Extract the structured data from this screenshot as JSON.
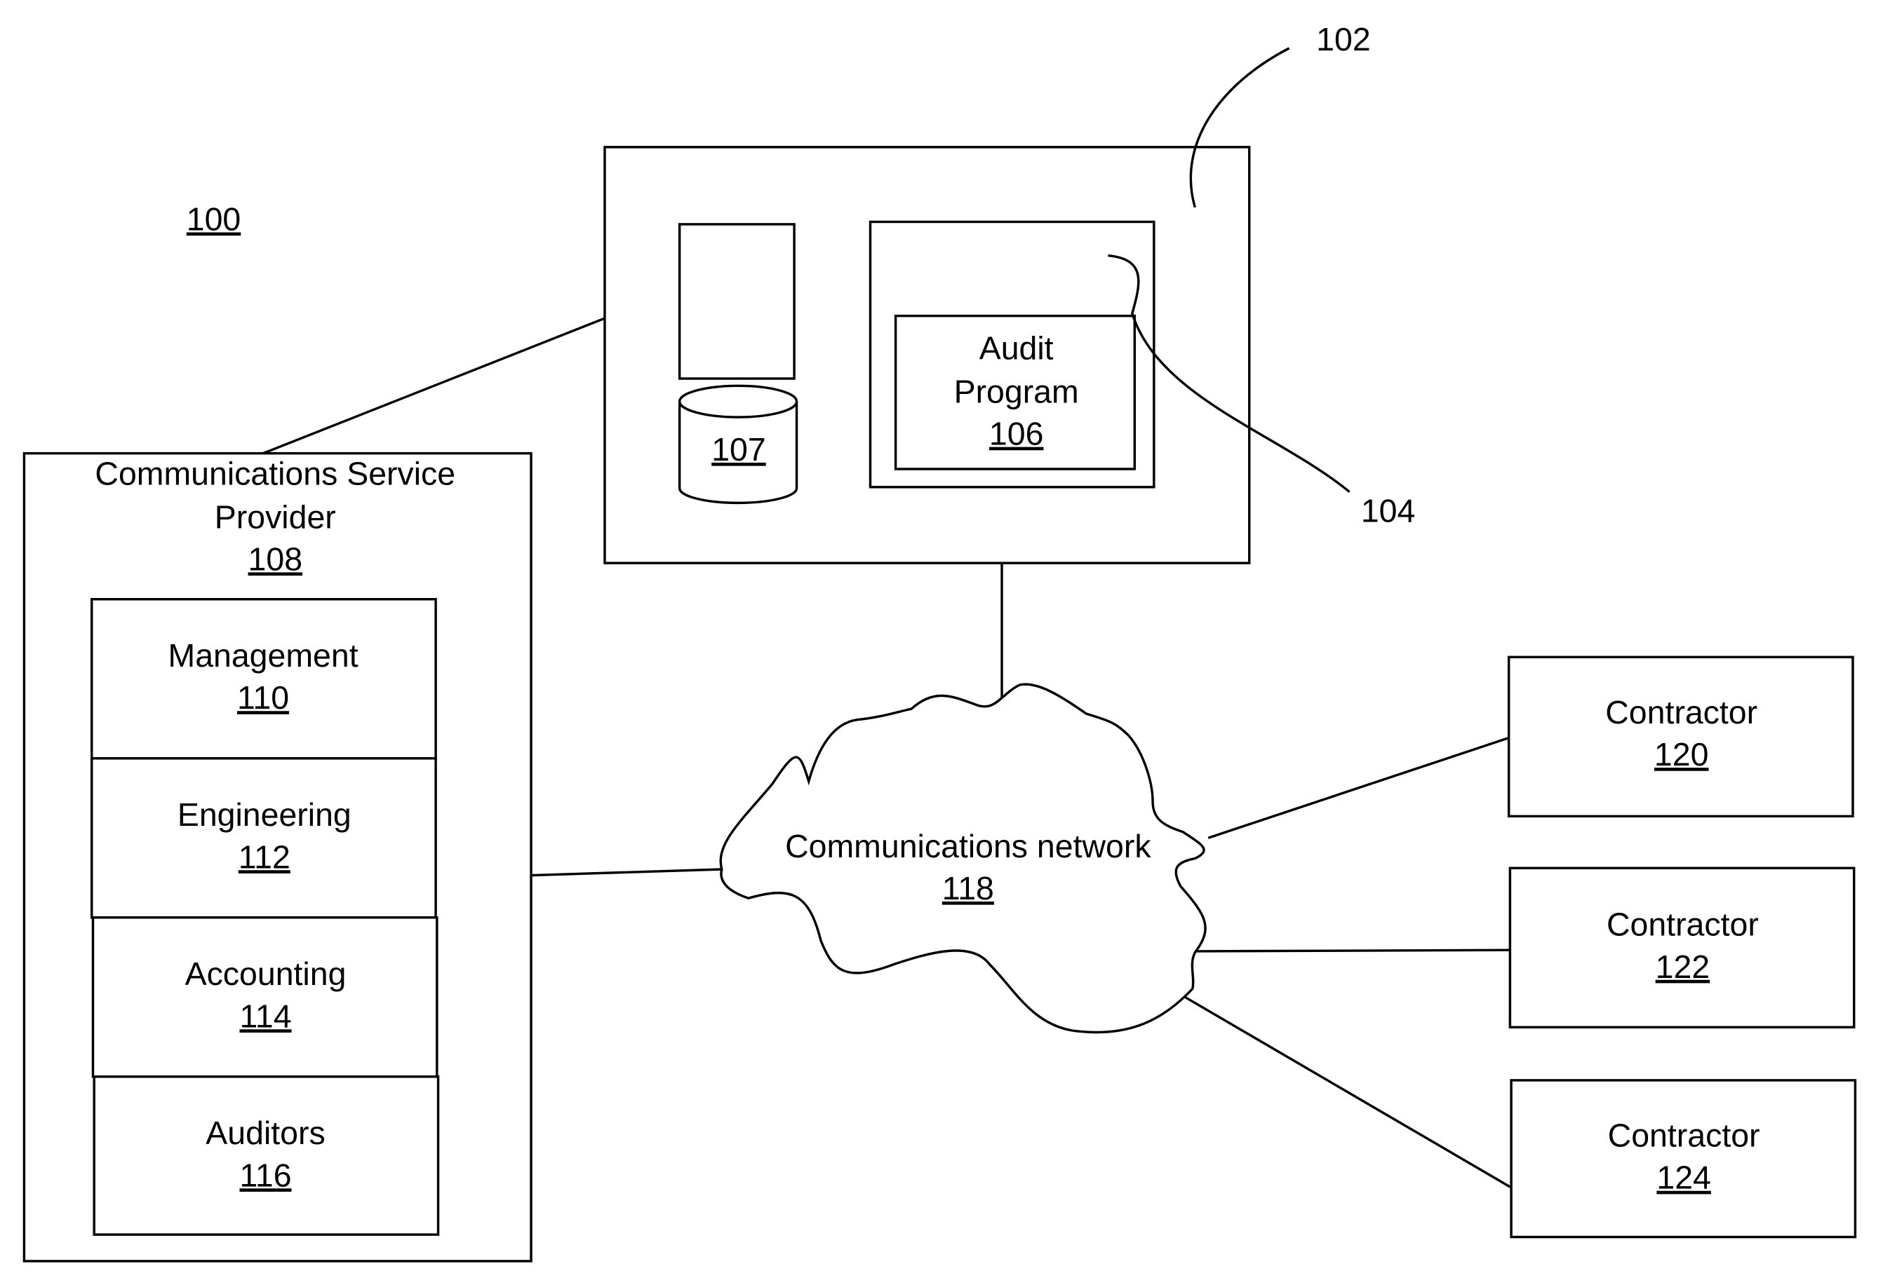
{
  "figure_label": "100",
  "server": {
    "ref": "102",
    "storage_ref": "107",
    "program_container_ref": "104",
    "program": {
      "line1": "Audit",
      "line2": "Program",
      "ref": "106"
    }
  },
  "provider": {
    "line1": "Communications Service",
    "line2": "Provider",
    "ref": "108",
    "departments": [
      {
        "label": "Management",
        "ref": "110"
      },
      {
        "label": "Engineering",
        "ref": "112"
      },
      {
        "label": "Accounting",
        "ref": "114"
      },
      {
        "label": "Auditors",
        "ref": "116"
      }
    ]
  },
  "network": {
    "label": "Communications network",
    "ref": "118"
  },
  "contractors": [
    {
      "label": "Contractor",
      "ref": "120"
    },
    {
      "label": "Contractor",
      "ref": "122"
    },
    {
      "label": "Contractor",
      "ref": "124"
    }
  ]
}
